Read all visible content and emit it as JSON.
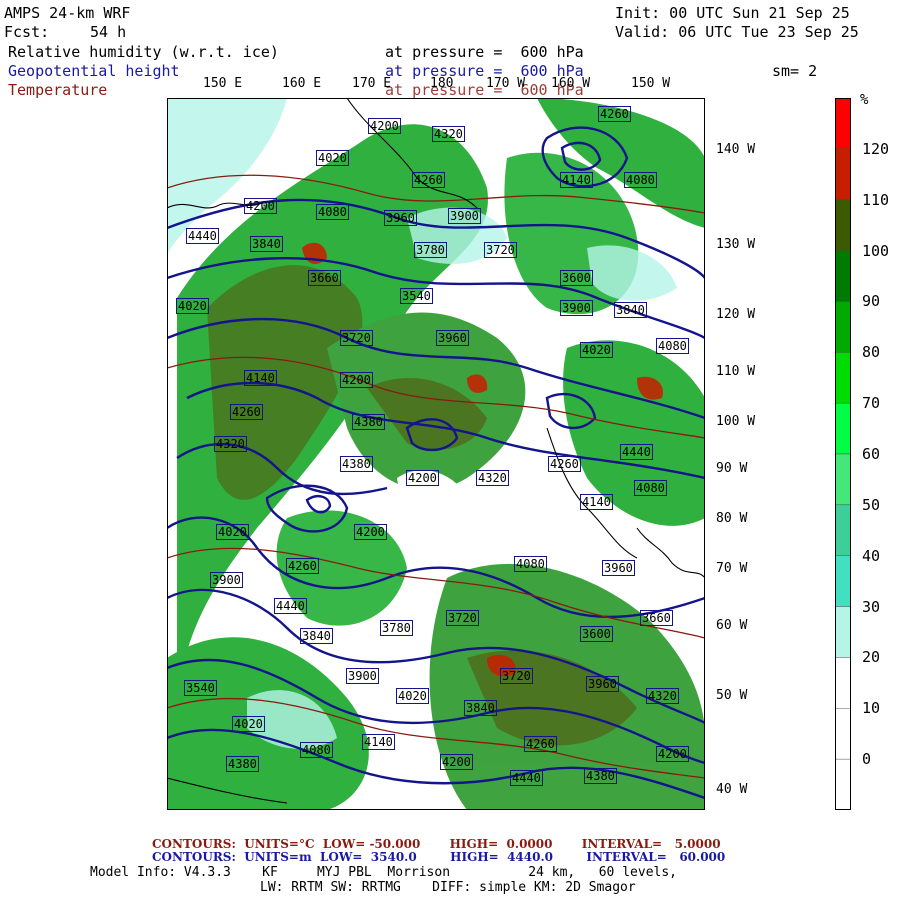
{
  "header": {
    "model": "AMPS 24-km WRF",
    "init": "Init: 00 UTC Sun 21 Sep 25",
    "fcst_label": "Fcst:",
    "fcst_value": "54 h",
    "valid": "Valid: 06 UTC Tue 23 Sep 25",
    "fields": [
      {
        "name": "Relative humidity (w.r.t. ice)",
        "pressure": "at pressure =  600 hPa",
        "color": "#000000"
      },
      {
        "name": "Geopotential height",
        "pressure": "at pressure =  600 hPa",
        "color": "#1a1aa0"
      },
      {
        "name": "Temperature",
        "pressure": "at pressure =  600 hPa",
        "color": "#8a1a10"
      }
    ],
    "smoothing": "sm= 2"
  },
  "map": {
    "top_lon_labels": [
      "150 E",
      "160 E",
      "170 E",
      "180",
      "170 W",
      "160 W",
      "150 W"
    ],
    "right_lon_labels": [
      "140 W",
      "130 W",
      "120 W",
      "110 W",
      "100 W",
      "90 W",
      "80 W",
      "70 W",
      "60 W",
      "50 W",
      "40 W"
    ],
    "height_labels": [
      "4200",
      "4320",
      "4260",
      "4140",
      "4080",
      "4020",
      "4260",
      "4200",
      "4080",
      "3960",
      "3900",
      "4440",
      "3840",
      "3780",
      "3720",
      "3660",
      "3600",
      "3540",
      "3900",
      "4020",
      "3840",
      "3720",
      "3960",
      "4020",
      "4080",
      "4140",
      "4200",
      "4260",
      "4320",
      "4380",
      "4440",
      "4380"
    ],
    "colors": {
      "height_contour": "#14148c",
      "temperature_contour": "#8a1a10",
      "coast": "#000000"
    }
  },
  "colorbar": {
    "unit": "%",
    "levels": [
      "120",
      "110",
      "100",
      "90",
      "80",
      "70",
      "60",
      "50",
      "40",
      "30",
      "20",
      "10",
      "0"
    ],
    "colors": [
      "#ff0000",
      "#c81e00",
      "#3c5a00",
      "#007a00",
      "#00aa00",
      "#00dc00",
      "#00ff44",
      "#44e87a",
      "#3ccf9a",
      "#40e0c0",
      "#b4f5e8",
      "#ffffff",
      "#ffffff",
      "#ffffff"
    ]
  },
  "footer": {
    "line1_label": "CONTOURS:  UNITS=°C  LOW= -50.000       HIGH=  0.0000       INTERVAL=   5.0000",
    "line2_label": "CONTOURS:  UNITS=m  LOW=  3540.0        HIGH=  4440.0        INTERVAL=   60.000",
    "model_info": "Model Info: V4.3.3    KF     MYJ PBL  Morrison          24 km,   60 levels,",
    "model_info2": "LW: RRTM SW: RRTMG    DIFF: simple KM: 2D Smagor"
  }
}
